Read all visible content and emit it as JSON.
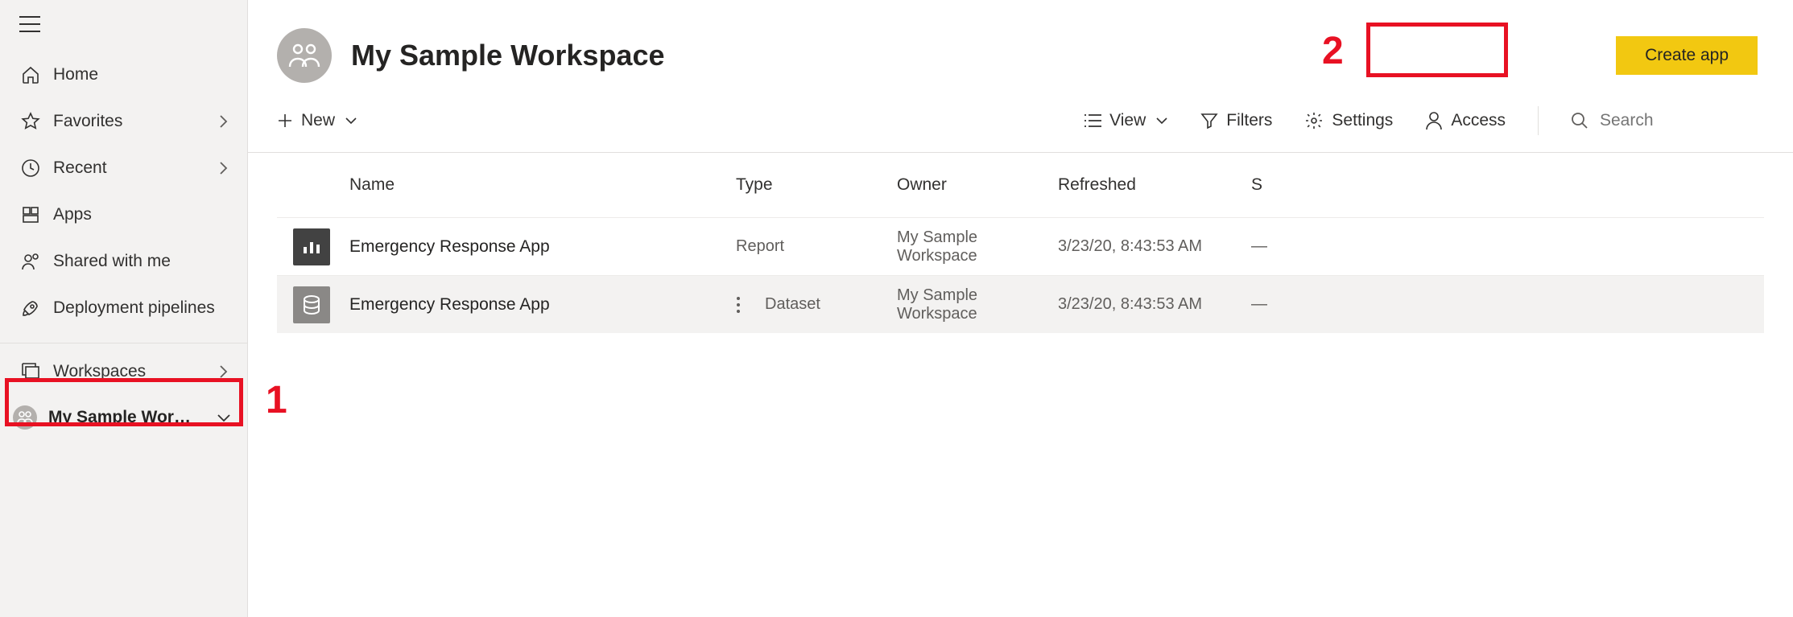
{
  "sidebar": {
    "items": [
      {
        "label": "Home",
        "icon": "home"
      },
      {
        "label": "Favorites",
        "icon": "star",
        "chevron": true
      },
      {
        "label": "Recent",
        "icon": "clock",
        "chevron": true
      },
      {
        "label": "Apps",
        "icon": "apps"
      },
      {
        "label": "Shared with me",
        "icon": "shared"
      },
      {
        "label": "Deployment pipelines",
        "icon": "rocket"
      }
    ],
    "workspaces_label": "Workspaces",
    "selected_workspace": "My Sample Works…"
  },
  "header": {
    "title": "My Sample Workspace",
    "create_app_label": "Create app"
  },
  "toolbar": {
    "new_label": "New",
    "view_label": "View",
    "filters_label": "Filters",
    "settings_label": "Settings",
    "access_label": "Access",
    "search_placeholder": "Search"
  },
  "table": {
    "columns": {
      "name": "Name",
      "type": "Type",
      "owner": "Owner",
      "refreshed": "Refreshed",
      "sensitivity": "S"
    },
    "rows": [
      {
        "name": "Emergency Response App",
        "type": "Report",
        "owner": "My Sample Workspace",
        "refreshed": "3/23/20, 8:43:53 AM",
        "sensitivity": "—",
        "icon": "report"
      },
      {
        "name": "Emergency Response App",
        "type": "Dataset",
        "owner": "My Sample Workspace",
        "refreshed": "3/23/20, 8:43:53 AM",
        "sensitivity": "—",
        "icon": "dataset"
      }
    ]
  },
  "annotations": {
    "num1": "1",
    "num2": "2"
  }
}
